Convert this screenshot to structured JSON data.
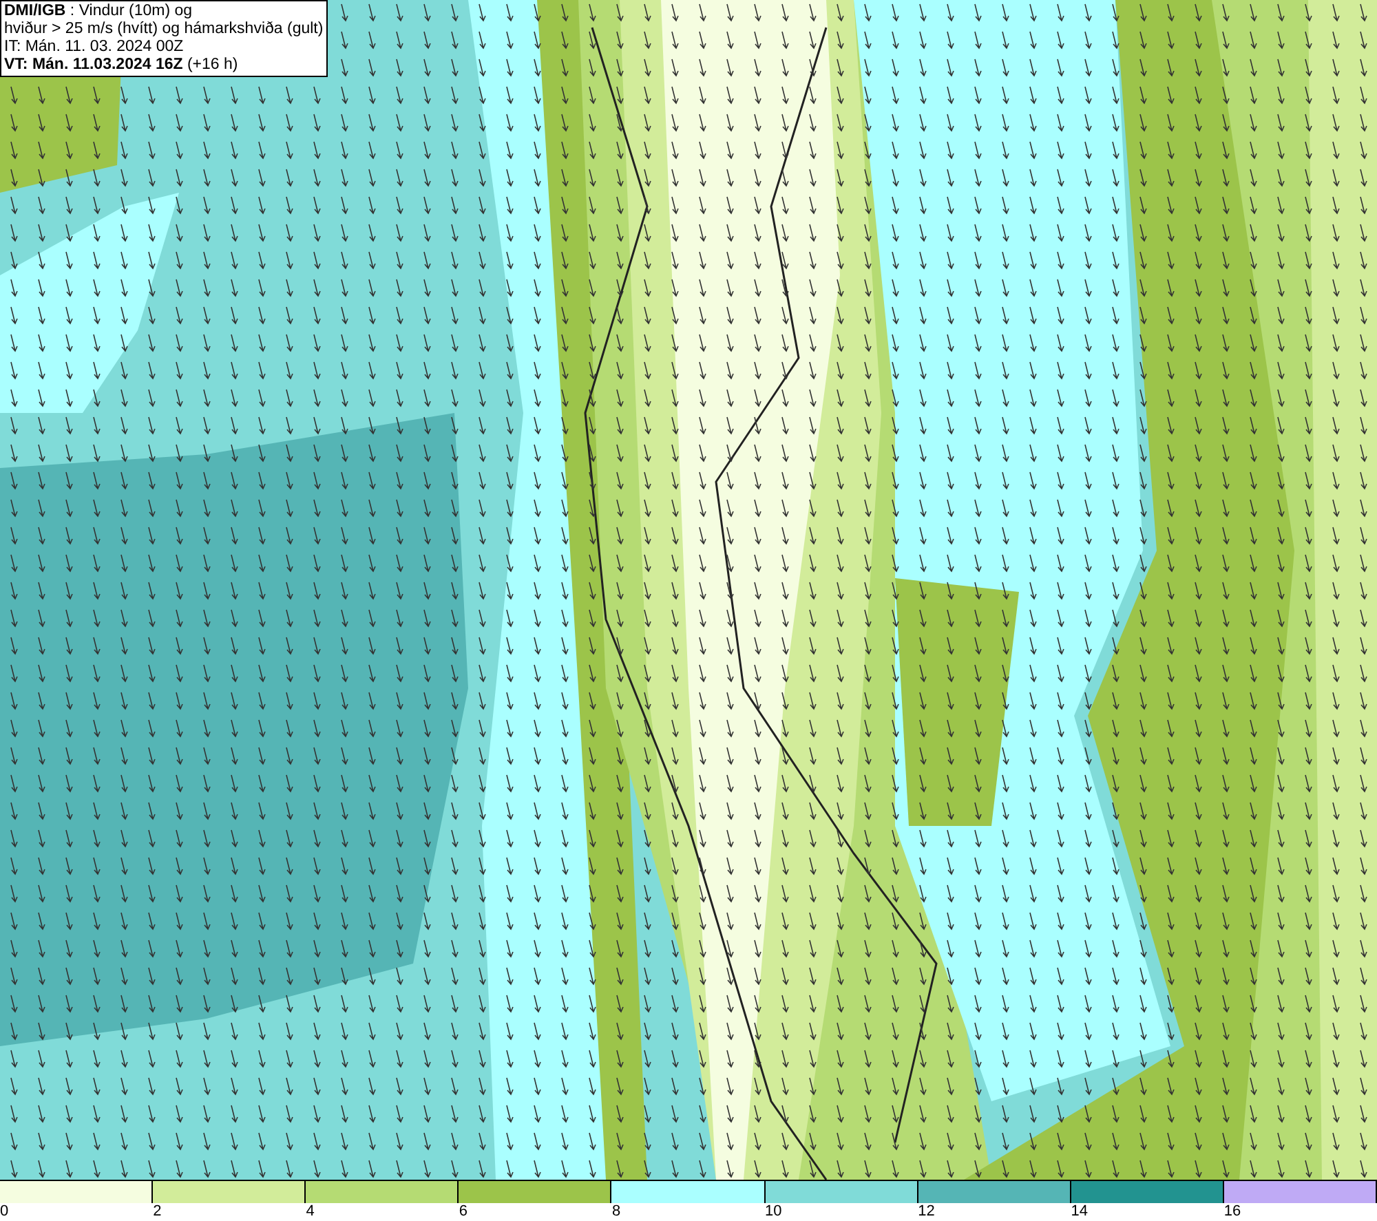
{
  "title_box": {
    "lines": [
      "**DMI/IGB** : Vindur (10m) og",
      "hviður > 25 m/s (hvítt) og hámarkshviða (gult)",
      "IT: Mán. 11. 03. 2024 00Z",
      "**VT: Mán. 11.03.2024 16Z** (+16 h)"
    ]
  },
  "legend": [
    {
      "label": "0",
      "color": "#f5fde0"
    },
    {
      "label": "2",
      "color": "#d2ec9a"
    },
    {
      "label": "4",
      "color": "#b5db73"
    },
    {
      "label": "6",
      "color": "#9cc44a"
    },
    {
      "label": "8",
      "color": "#aaffff"
    },
    {
      "label": "10",
      "color": "#80dbd8"
    },
    {
      "label": "12",
      "color": "#55b5b5"
    },
    {
      "label": "14",
      "color": "#229390"
    },
    {
      "label": "16",
      "color": "#bfaaf5"
    }
  ]
}
